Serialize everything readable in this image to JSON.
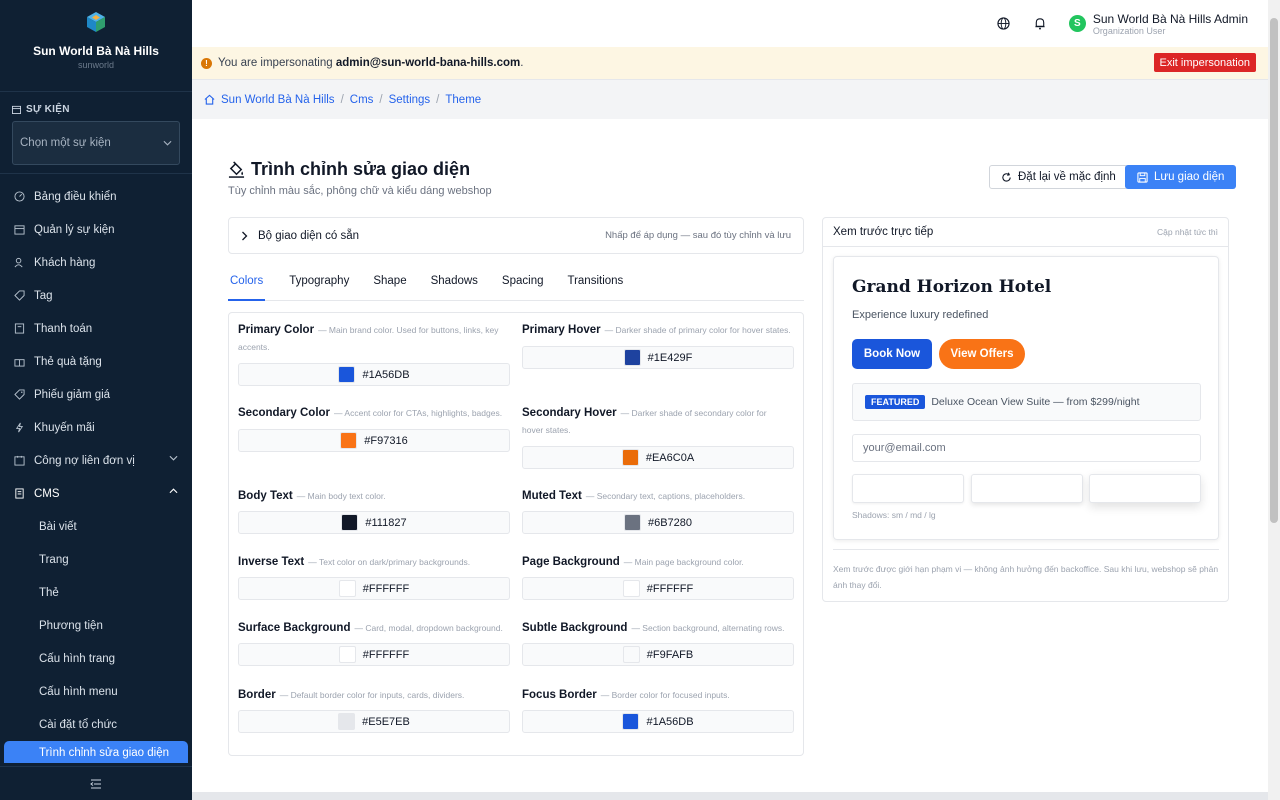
{
  "sidebar": {
    "brand_name": "Sun World Bà Nà Hills",
    "brand_sub": "sunworld",
    "section_label": "SỰ KIỆN",
    "event_select_placeholder": "Chọn một sự kiện",
    "items": [
      {
        "label": "Bảng điều khiển",
        "icon": "dashboard-icon"
      },
      {
        "label": "Quản lý sự kiện",
        "icon": "calendar-icon"
      },
      {
        "label": "Khách hàng",
        "icon": "users-icon"
      },
      {
        "label": "Tag",
        "icon": "tag-icon"
      },
      {
        "label": "Thanh toán",
        "icon": "receipt-icon"
      },
      {
        "label": "Thẻ quà tặng",
        "icon": "gift-icon"
      },
      {
        "label": "Phiếu giảm giá",
        "icon": "coupon-icon"
      },
      {
        "label": "Khuyến mãi",
        "icon": "lightning-icon"
      },
      {
        "label": "Công nợ liên đơn vị",
        "icon": "debt-icon"
      }
    ],
    "cms_label": "CMS",
    "cms_items": [
      "Bài viết",
      "Trang",
      "Thẻ",
      "Phương tiện",
      "Cấu hình trang",
      "Cấu hình menu",
      "Cài đặt tổ chức",
      "Trình chỉnh sửa giao diện"
    ]
  },
  "topbar": {
    "user_initial": "S",
    "user_name": "Sun World Bà Nà Hills Admin",
    "user_role": "Organization User"
  },
  "impersonation": {
    "prefix": "You are impersonating",
    "email": "admin@sun-world-bana-hills.com",
    "suffix": ".",
    "exit_label": "Exit impersonation"
  },
  "breadcrumbs": [
    "Sun World Bà Nà Hills",
    "Cms",
    "Settings",
    "Theme"
  ],
  "page": {
    "title": "Trình chỉnh sửa giao diện",
    "subtitle": "Tùy chỉnh màu sắc, phông chữ và kiểu dáng webshop",
    "reset_label": "Đặt lại về mặc định",
    "save_label": "Lưu giao diện"
  },
  "presets": {
    "label": "Bộ giao diện có sẵn",
    "hint": "Nhấp để áp dụng — sau đó tùy chỉnh và lưu"
  },
  "tabs": [
    "Colors",
    "Typography",
    "Shape",
    "Shadows",
    "Spacing",
    "Transitions"
  ],
  "active_tab": "Colors",
  "colors": [
    {
      "label": "Primary Color",
      "desc": "— Main brand color. Used for buttons, links, key accents.",
      "hex": "#1A56DB"
    },
    {
      "label": "Primary Hover",
      "desc": "— Darker shade of primary color for hover states.",
      "hex": "#1E429F"
    },
    {
      "label": "Secondary Color",
      "desc": "— Accent color for CTAs, highlights, badges.",
      "hex": "#F97316"
    },
    {
      "label": "Secondary Hover",
      "desc": "— Darker shade of secondary color for hover states.",
      "hex": "#EA6C0A"
    },
    {
      "label": "Body Text",
      "desc": "— Main body text color.",
      "hex": "#111827"
    },
    {
      "label": "Muted Text",
      "desc": "— Secondary text, captions, placeholders.",
      "hex": "#6B7280"
    },
    {
      "label": "Inverse Text",
      "desc": "— Text color on dark/primary backgrounds.",
      "hex": "#FFFFFF"
    },
    {
      "label": "Page Background",
      "desc": "— Main page background color.",
      "hex": "#FFFFFF"
    },
    {
      "label": "Surface Background",
      "desc": "— Card, modal, dropdown background.",
      "hex": "#FFFFFF"
    },
    {
      "label": "Subtle Background",
      "desc": "— Section background, alternating rows.",
      "hex": "#F9FAFB"
    },
    {
      "label": "Border",
      "desc": "— Default border color for inputs, cards, dividers.",
      "hex": "#E5E7EB"
    },
    {
      "label": "Focus Border",
      "desc": "— Border color for focused inputs.",
      "hex": "#1A56DB"
    }
  ],
  "preview": {
    "heading": "Xem trước trực tiếp",
    "live_label": "Cập nhật tức thì",
    "hotel_name": "Grand Horizon Hotel",
    "tagline": "Experience luxury redefined",
    "book_label": "Book Now",
    "offers_label": "View Offers",
    "featured_badge": "FEATURED",
    "featured_text": "Deluxe Ocean View Suite — from $299/night",
    "email_placeholder": "your@email.com",
    "shadows_label": "Shadows: sm / md / lg",
    "note": "Xem trước được giới hạn phạm vi — không ảnh hưởng đến backoffice. Sau khi lưu, webshop sẽ phản ánh thay đổi."
  }
}
